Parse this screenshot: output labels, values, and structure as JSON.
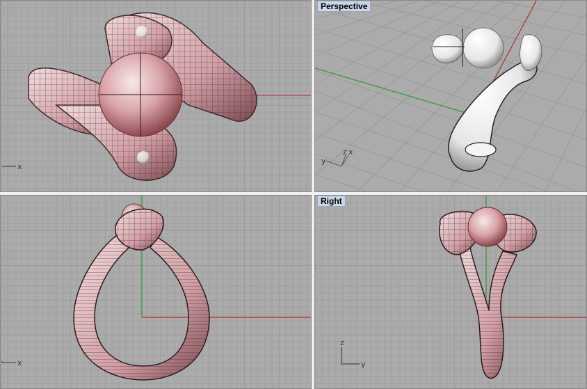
{
  "viewports": {
    "top": {
      "title": "",
      "axes": {
        "h": "x",
        "v": ""
      }
    },
    "perspective": {
      "title": "Perspective",
      "axes": {
        "a": "y",
        "b": "z",
        "c": "x"
      }
    },
    "front": {
      "title": "",
      "axes": {
        "h": "x",
        "v": ""
      }
    },
    "right": {
      "title": "Right",
      "axes": {
        "h": "y",
        "v": "z"
      }
    }
  },
  "colors": {
    "viewport_bg": "#ababab",
    "grid_minor": "#9f9f9f",
    "grid_major": "#8e8e8e",
    "x_axis": "#b5292a",
    "y_axis": "#2a9a2a",
    "model_wire": "#3a2a2a",
    "model_fill": "#e3c2c6",
    "shaded_model": "#f2f2f2",
    "title_bg": "#c9d6e6"
  }
}
